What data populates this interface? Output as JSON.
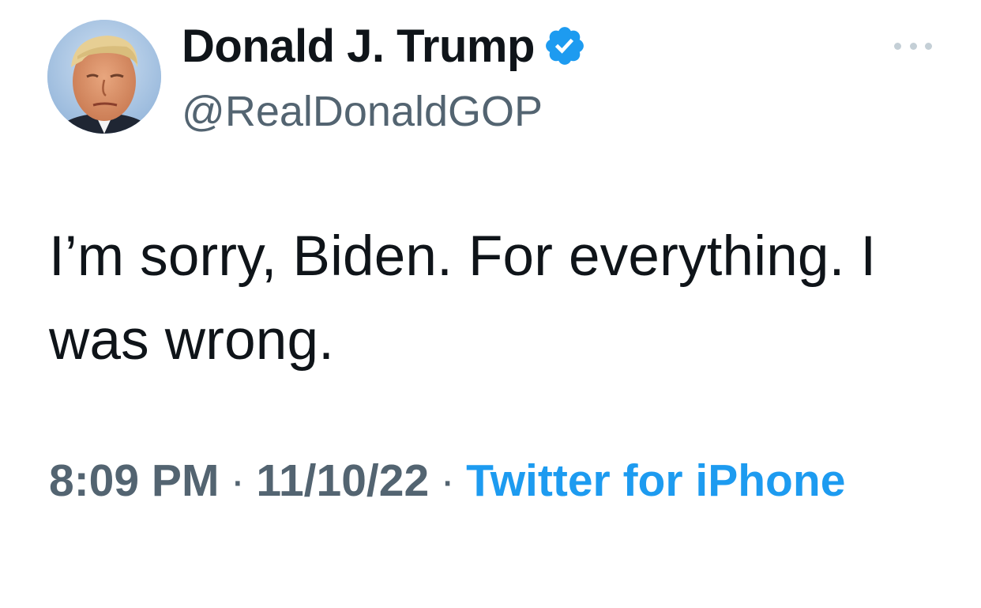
{
  "author": {
    "display_name": "Donald J. Trump",
    "handle": "@RealDonaldGOP",
    "verified": true,
    "avatar_icon": "profile-photo"
  },
  "tweet": {
    "text": "I’m sorry, Biden. For everything. I was wrong.",
    "time": "8:09 PM",
    "date": "11/10/22",
    "separator": "·",
    "source": "Twitter for iPhone"
  },
  "icons": {
    "verified": "verified-badge-icon",
    "more": "more-options-icon"
  },
  "colors": {
    "text_primary": "#0f1419",
    "text_secondary": "#536471",
    "accent": "#1d9bf0",
    "icon_muted": "#c4cfd6",
    "background": "#ffffff"
  }
}
